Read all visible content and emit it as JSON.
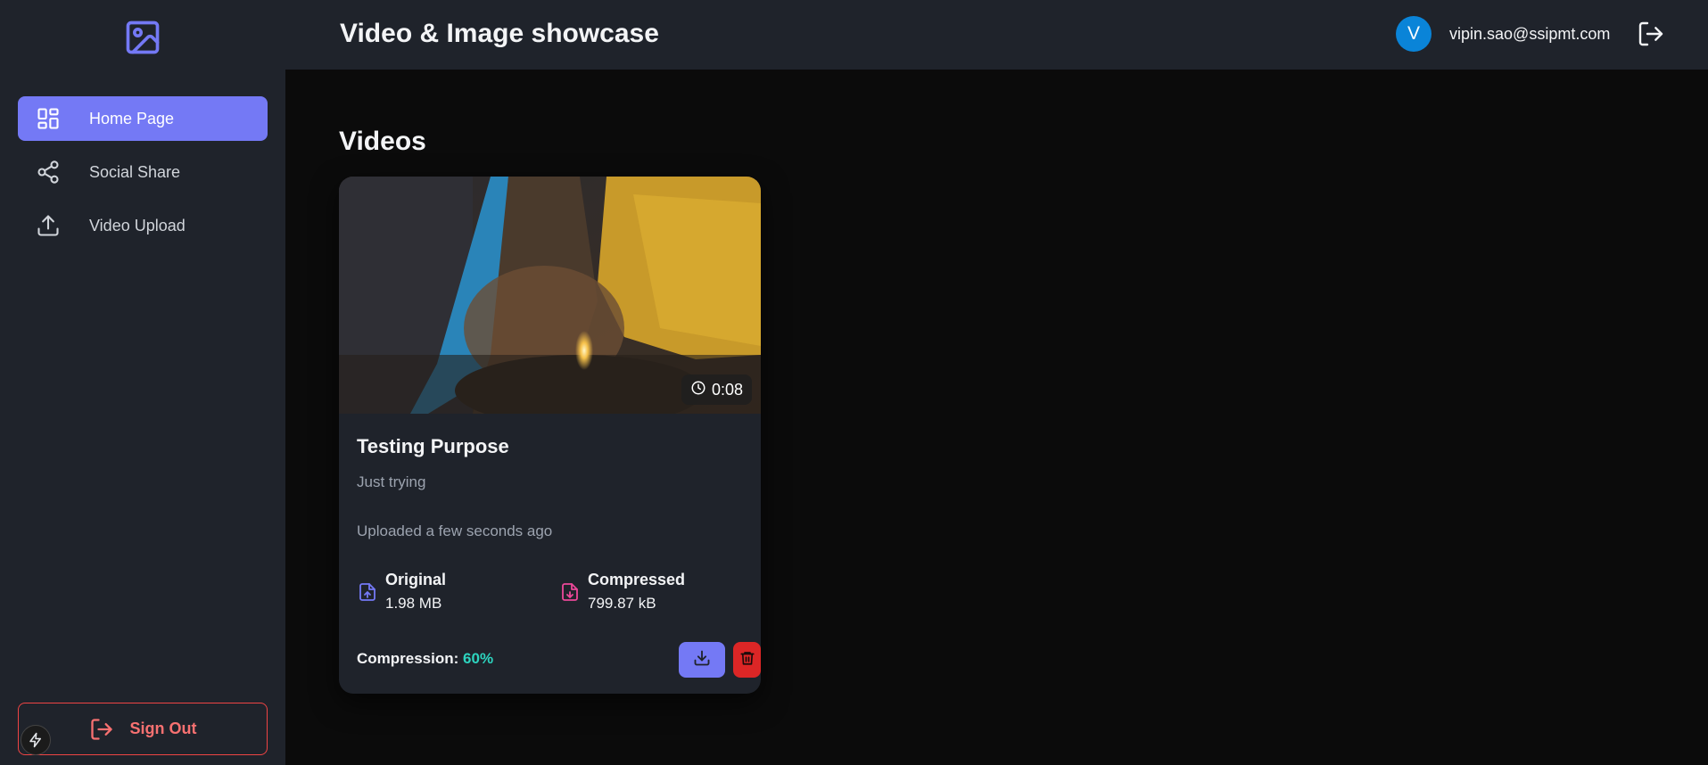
{
  "header": {
    "title": "Video & Image showcase",
    "user_initial": "V",
    "user_email": "vipin.sao@ssipmt.com",
    "logout_icon": "logout-icon"
  },
  "sidebar": {
    "logo_icon": "image-icon",
    "items": [
      {
        "label": "Home Page",
        "icon": "dashboard-icon",
        "active": true
      },
      {
        "label": "Social Share",
        "icon": "share-icon",
        "active": false
      },
      {
        "label": "Video Upload",
        "icon": "upload-icon",
        "active": false
      }
    ],
    "sign_out_label": "Sign Out"
  },
  "main": {
    "section_title": "Videos",
    "videos": [
      {
        "duration": "0:08",
        "title": "Testing Purpose",
        "description": "Just trying",
        "uploaded": "Uploaded a few seconds ago",
        "original_label": "Original",
        "original_size": "1.98 MB",
        "compressed_label": "Compressed",
        "compressed_size": "799.87 kB",
        "compression_label": "Compression:",
        "compression_value": "60%"
      }
    ]
  },
  "colors": {
    "accent": "#7479f5",
    "danger": "#dc2626",
    "success": "#2dd4bf",
    "avatar": "#0a84d8",
    "panel": "#1f232b",
    "background": "#0b0b0b"
  }
}
